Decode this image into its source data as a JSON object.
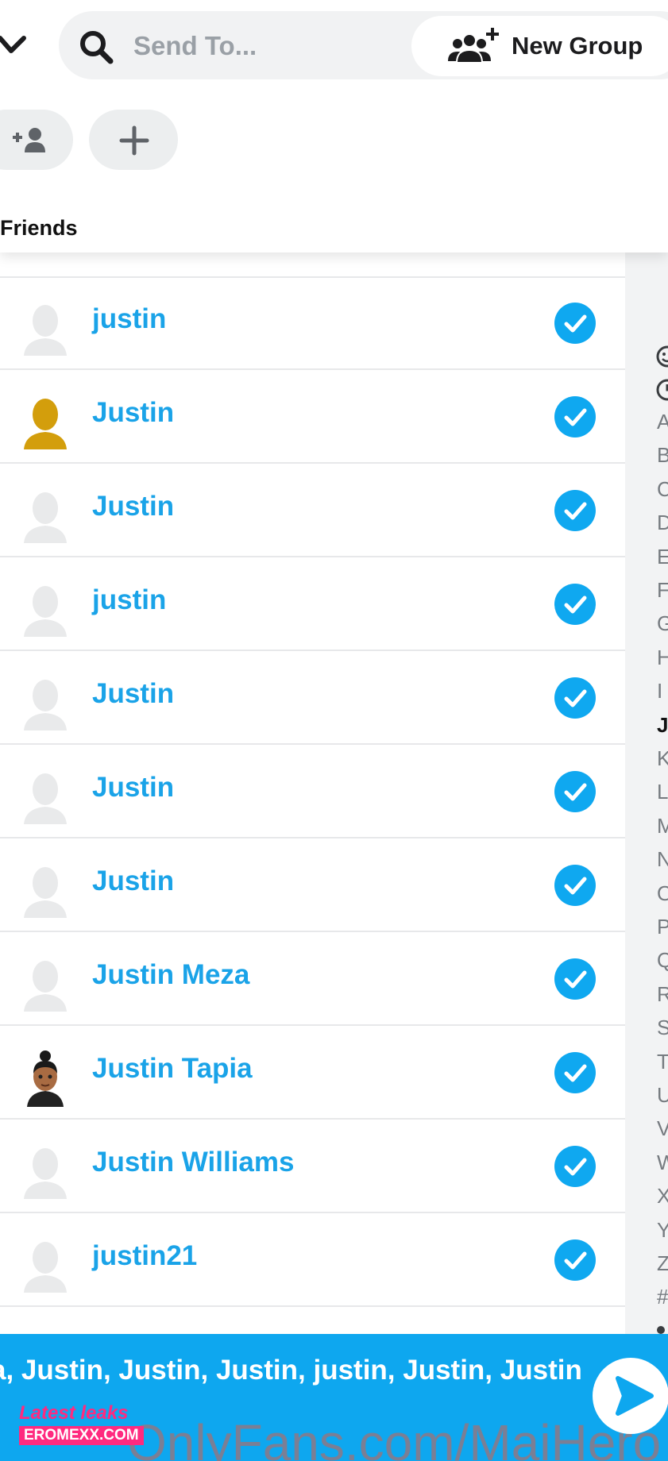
{
  "header": {
    "search_placeholder": "Send To...",
    "new_group_label": "New Group",
    "section_title": "Friends"
  },
  "icons": {
    "back": "chevron-down-icon",
    "search": "search-icon",
    "new_group": "group-add-icon",
    "add_friend": "add-friend-icon",
    "add": "plus-icon",
    "check": "check-icon",
    "send": "send-arrow-icon"
  },
  "colors": {
    "accent": "#0fa8f0",
    "name_text": "#1aa3e8",
    "send_bar": "#0ea7ef",
    "avatar_placeholder": "#e9eaeb",
    "gold_avatar": "#d39e0c"
  },
  "friends": [
    {
      "name": "justin",
      "avatar": "placeholder",
      "selected": true
    },
    {
      "name": "Justin",
      "avatar": "gold",
      "selected": true
    },
    {
      "name": "Justin",
      "avatar": "placeholder",
      "selected": true
    },
    {
      "name": "justin",
      "avatar": "placeholder",
      "selected": true
    },
    {
      "name": "Justin",
      "avatar": "placeholder",
      "selected": true
    },
    {
      "name": "Justin",
      "avatar": "placeholder",
      "selected": true
    },
    {
      "name": "Justin",
      "avatar": "placeholder",
      "selected": true
    },
    {
      "name": "Justin Meza",
      "avatar": "placeholder",
      "selected": true
    },
    {
      "name": "Justin Tapia",
      "avatar": "bitmoji",
      "selected": true
    },
    {
      "name": "Justin Williams",
      "avatar": "placeholder",
      "selected": true
    },
    {
      "name": "justin21",
      "avatar": "placeholder",
      "selected": true
    }
  ],
  "index_rail": {
    "letters": [
      "A",
      "B",
      "C",
      "D",
      "E",
      "F",
      "G",
      "H",
      "I",
      "J",
      "K",
      "L",
      "M",
      "N",
      "O",
      "P",
      "Q",
      "R",
      "S",
      "T",
      "U",
      "V",
      "W",
      "X",
      "Y",
      "Z",
      "#"
    ],
    "active": "J"
  },
  "send_bar": {
    "selected_text": "a, Justin, Justin, Justin, justin, Justin, Justin"
  },
  "watermark": {
    "line1": "Latest leaks",
    "line2": "EROMEXX.COM",
    "overlay": "OnlyFans.com/MaiHero"
  }
}
